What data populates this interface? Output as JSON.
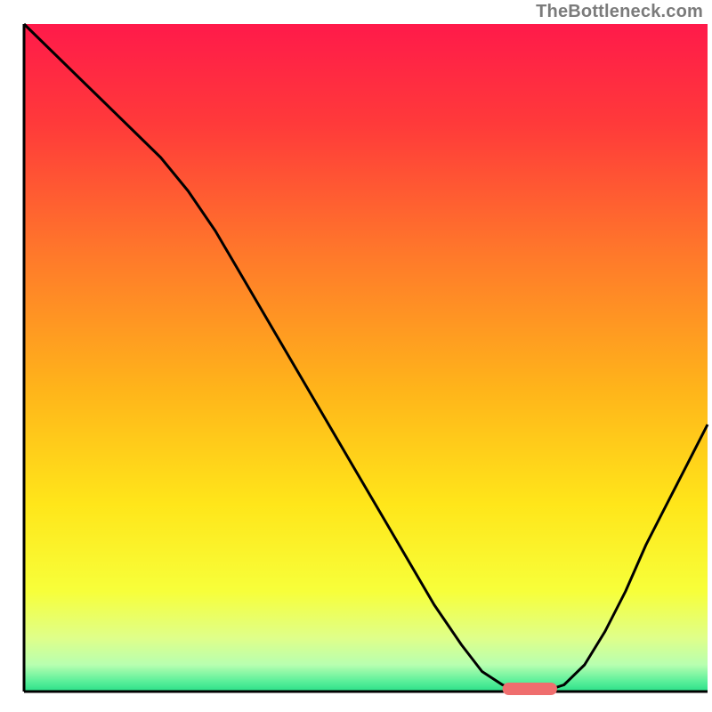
{
  "attribution": "TheBottleneck.com",
  "chart_data": {
    "type": "line",
    "title": "",
    "xlabel": "",
    "ylabel": "",
    "xlim": [
      0,
      100
    ],
    "ylim": [
      0,
      100
    ],
    "grid": false,
    "legend": false,
    "x": [
      0,
      4,
      8,
      12,
      16,
      20,
      24,
      28,
      32,
      36,
      40,
      44,
      48,
      52,
      56,
      60,
      64,
      67,
      70,
      73,
      76,
      79,
      82,
      85,
      88,
      91,
      94,
      97,
      100
    ],
    "y": [
      100,
      96,
      92,
      88,
      84,
      80,
      75,
      69,
      62,
      55,
      48,
      41,
      34,
      27,
      20,
      13,
      7,
      3,
      1,
      0,
      0,
      1,
      4,
      9,
      15,
      22,
      28,
      34,
      40
    ],
    "marker": {
      "x_range": [
        70,
        78
      ],
      "y": 0,
      "color": "#ef6e6e"
    },
    "background_gradient": {
      "stops": [
        {
          "offset": 0.0,
          "color": "#ff1a4a"
        },
        {
          "offset": 0.15,
          "color": "#ff3a3a"
        },
        {
          "offset": 0.35,
          "color": "#ff7a2a"
        },
        {
          "offset": 0.55,
          "color": "#ffb51a"
        },
        {
          "offset": 0.72,
          "color": "#ffe61a"
        },
        {
          "offset": 0.85,
          "color": "#f7ff3a"
        },
        {
          "offset": 0.92,
          "color": "#dfff8a"
        },
        {
          "offset": 0.96,
          "color": "#b8ffb0"
        },
        {
          "offset": 0.985,
          "color": "#5aef9a"
        },
        {
          "offset": 1.0,
          "color": "#2adf88"
        }
      ]
    }
  }
}
